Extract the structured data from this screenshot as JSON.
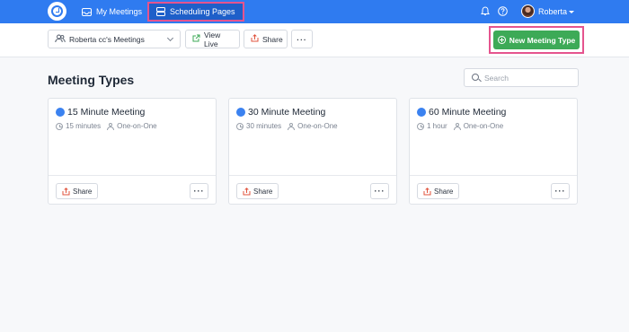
{
  "nav": {
    "my_meetings": "My Meetings",
    "scheduling_pages": "Scheduling Pages",
    "user": "Roberta"
  },
  "toolbar": {
    "page_select": "Roberta cc's Meetings",
    "view_live": "View Live",
    "share": "Share",
    "more": "···",
    "new_meeting_type": "New Meeting Type"
  },
  "main": {
    "title": "Meeting Types",
    "search_placeholder": "Search"
  },
  "cards": [
    {
      "title": "15 Minute Meeting",
      "duration": "15 minutes",
      "type": "One-on-One",
      "share": "Share",
      "more": "···"
    },
    {
      "title": "30 Minute Meeting",
      "duration": "30 minutes",
      "type": "One-on-One",
      "share": "Share",
      "more": "···"
    },
    {
      "title": "60 Minute Meeting",
      "duration": "1 hour",
      "type": "One-on-One",
      "share": "Share",
      "more": "···"
    }
  ],
  "colors": {
    "nav_bg": "#2f7bf0",
    "primary_green": "#3daa57",
    "highlight": "#e5548e",
    "dot_blue": "#3b82f0"
  },
  "icons": {
    "logo": "calendar-check-logo",
    "my_meetings": "inbox-icon",
    "scheduling_pages": "layers-icon",
    "bell": "bell-icon",
    "help": "question-circle-icon"
  }
}
